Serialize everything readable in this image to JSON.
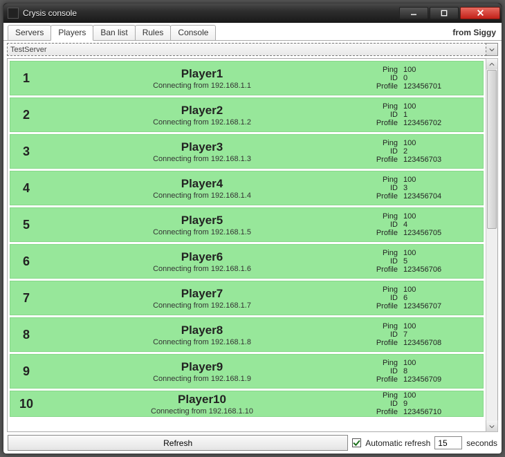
{
  "window": {
    "title": "Crysis console"
  },
  "brand": "from Siggy",
  "tabs": [
    "Servers",
    "Players",
    "Ban list",
    "Rules",
    "Console"
  ],
  "active_tab_index": 1,
  "server_selector": {
    "value": "TestServer"
  },
  "stat_labels": {
    "ping": "Ping",
    "id": "ID",
    "profile": "Profile"
  },
  "conn_prefix": "Connecting from ",
  "players": [
    {
      "rank": "1",
      "name": "Player1",
      "ip": "192.168.1.1",
      "ping": "100",
      "id": "0",
      "profile": "123456701"
    },
    {
      "rank": "2",
      "name": "Player2",
      "ip": "192.168.1.2",
      "ping": "100",
      "id": "1",
      "profile": "123456702"
    },
    {
      "rank": "3",
      "name": "Player3",
      "ip": "192.168.1.3",
      "ping": "100",
      "id": "2",
      "profile": "123456703"
    },
    {
      "rank": "4",
      "name": "Player4",
      "ip": "192.168.1.4",
      "ping": "100",
      "id": "3",
      "profile": "123456704"
    },
    {
      "rank": "5",
      "name": "Player5",
      "ip": "192.168.1.5",
      "ping": "100",
      "id": "4",
      "profile": "123456705"
    },
    {
      "rank": "6",
      "name": "Player6",
      "ip": "192.168.1.6",
      "ping": "100",
      "id": "5",
      "profile": "123456706"
    },
    {
      "rank": "7",
      "name": "Player7",
      "ip": "192.168.1.7",
      "ping": "100",
      "id": "6",
      "profile": "123456707"
    },
    {
      "rank": "8",
      "name": "Player8",
      "ip": "192.168.1.8",
      "ping": "100",
      "id": "7",
      "profile": "123456708"
    },
    {
      "rank": "9",
      "name": "Player9",
      "ip": "192.168.1.9",
      "ping": "100",
      "id": "8",
      "profile": "123456709"
    },
    {
      "rank": "10",
      "name": "Player10",
      "ip": "192.168.1.10",
      "ping": "100",
      "id": "9",
      "profile": "123456710"
    }
  ],
  "footer": {
    "refresh_label": "Refresh",
    "auto_label": "Automatic refresh",
    "auto_checked": true,
    "interval": "15",
    "seconds_label": "seconds"
  }
}
